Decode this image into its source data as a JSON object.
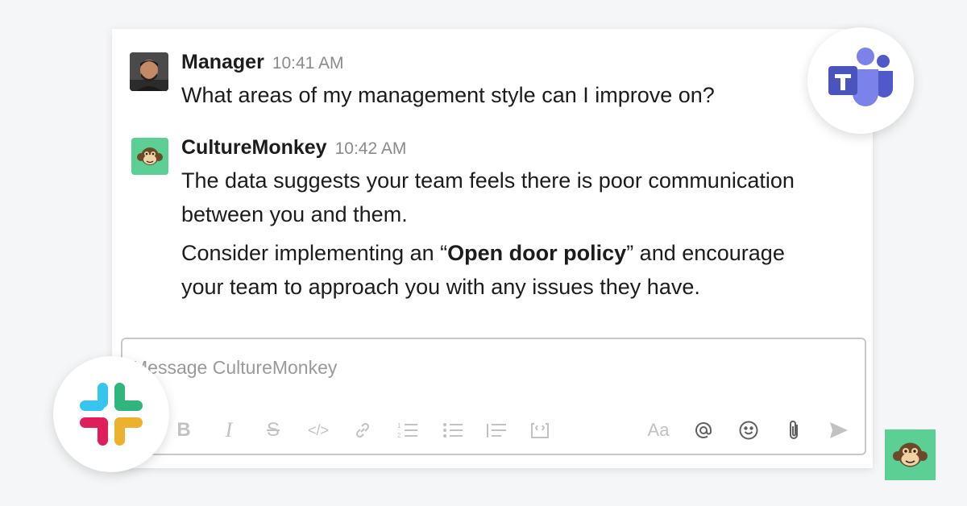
{
  "messages": [
    {
      "sender": "Manager",
      "time": "10:41 AM",
      "lines": [
        "What areas of my management style can I improve on?"
      ]
    },
    {
      "sender": "CultureMonkey",
      "time": "10:42 AM",
      "lines": [
        "The data suggests your team feels there is poor communication",
        "between you and them."
      ],
      "para2_before": "Consider implementing an “",
      "para2_bold": "Open door policy",
      "para2_after": "” and encourage",
      "para2_line2": "your team to approach you with any issues they have."
    }
  ],
  "composer": {
    "placeholder": "Message CultureMonkey",
    "font_button": "Aa"
  },
  "toolbar_icons": [
    "bold-icon",
    "italic-icon",
    "strikethrough-icon",
    "code-icon",
    "link-icon",
    "ordered-list-icon",
    "bulleted-list-icon",
    "blockquote-icon",
    "code-block-icon",
    "format-icon",
    "mention-icon",
    "emoji-icon",
    "attachment-icon",
    "send-icon"
  ],
  "colors": {
    "background": "#f5f6f8",
    "culturemonkey_green": "#5ccf95",
    "teams_purple": "#5059c9",
    "muted_icon": "#c2c2c2"
  },
  "brand_logos": [
    "microsoft-teams-logo",
    "slack-logo",
    "culturemonkey-logo"
  ]
}
